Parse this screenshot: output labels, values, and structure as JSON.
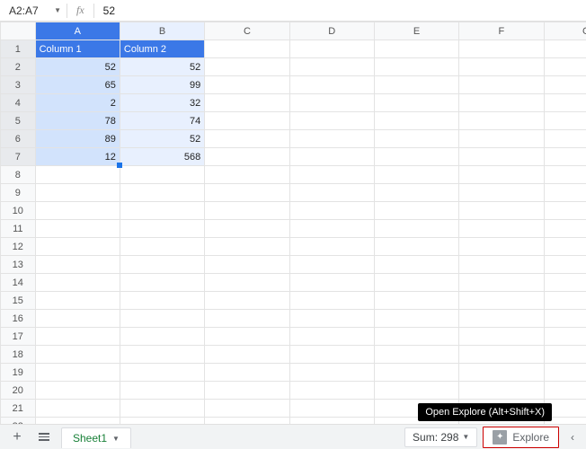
{
  "nameBox": {
    "range": "A2:A7"
  },
  "formulaBar": {
    "label": "fx",
    "value": "52"
  },
  "columns": [
    "A",
    "B",
    "C",
    "D",
    "E",
    "F",
    "G"
  ],
  "rowCount": 23,
  "headers": {
    "A": "Column 1",
    "B": "Column 2"
  },
  "cells": {
    "A2": "52",
    "B2": "52",
    "A3": "65",
    "B3": "99",
    "A4": "2",
    "B4": "32",
    "A5": "78",
    "B5": "74",
    "A6": "89",
    "B6": "52",
    "A7": "12",
    "B7": "568"
  },
  "selection": {
    "range": "A2:A7",
    "activeCell": "A7"
  },
  "bottomBar": {
    "sheetTab": "Sheet1",
    "summary": "Sum: 298",
    "explore": "Explore",
    "tooltip": "Open Explore (Alt+Shift+X)"
  }
}
